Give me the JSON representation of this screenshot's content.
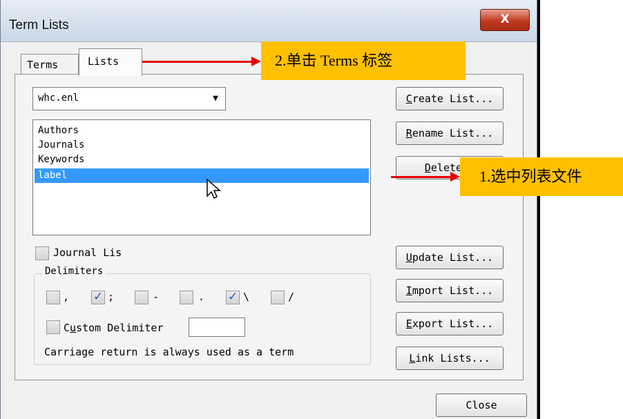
{
  "window": {
    "title": "Term Lists",
    "close_glyph": "X"
  },
  "tabs": {
    "terms": "Terms",
    "lists": "Lists"
  },
  "library_select": {
    "value": "whc.enl"
  },
  "list_items": [
    "Authors",
    "Journals",
    "Keywords",
    "label"
  ],
  "selected_item": "label",
  "buttons": {
    "create": {
      "key": "C",
      "rest": "reate List..."
    },
    "rename": {
      "key": "R",
      "rest": "ename List..."
    },
    "delete": {
      "key": "D",
      "rest": "elete L"
    },
    "update": {
      "key": "U",
      "rest": "pdate List..."
    },
    "import": {
      "key": "I",
      "rest": "mport List..."
    },
    "export": {
      "key": "E",
      "rest": "xport List..."
    },
    "link": {
      "key": "L",
      "rest": "ink Lists..."
    },
    "close": "Close"
  },
  "journal_list": {
    "label": "Journal Lis",
    "checked": false
  },
  "delimiters": {
    "title": "Delimiters",
    "items": [
      {
        "char": ",",
        "checked": false
      },
      {
        "char": ";",
        "checked": true
      },
      {
        "char": "-",
        "checked": false
      },
      {
        "char": ".",
        "checked": false
      },
      {
        "char": "\\",
        "checked": true
      },
      {
        "char": "/",
        "checked": false
      }
    ],
    "custom": {
      "label_pre": "C",
      "label_key": "u",
      "label_post": "stom Delimiter",
      "checked": false,
      "value": ""
    },
    "note": "Carriage return is always used as a term"
  },
  "annotations": {
    "step2": "2.单击 Terms 标签",
    "step1": "1.选中列表文件"
  },
  "colors": {
    "callout": "#ffc000",
    "arrow": "#e60000",
    "selection": "#3399ff"
  }
}
